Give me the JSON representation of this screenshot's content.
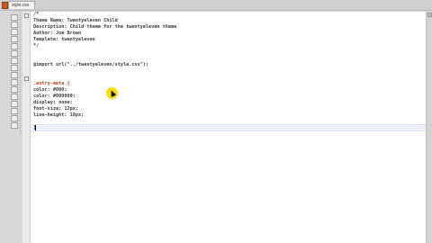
{
  "tab": {
    "label": "style.css"
  },
  "toolbar": {
    "buttons": [
      "tool-1",
      "tool-2",
      "tool-3",
      "tool-4",
      "tool-5",
      "tool-6",
      "tool-7",
      "tool-8",
      "tool-9",
      "tool-10",
      "tool-11",
      "tool-12",
      "tool-13",
      "tool-14",
      "tool-15",
      "tool-16"
    ]
  },
  "editor": {
    "lines": [
      "/*",
      "Theme Name: Twentyeleven Child",
      "Description: Child theme for the twentyeleven theme",
      "Author: Joe Brown",
      "Template: twentyeleven",
      "*/",
      "",
      "@import url(\"../twentyeleven/style.css\");",
      "",
      "",
      ".entry-meta {",
      "color: #000;",
      "color: #000000;",
      "display: none;",
      "font-size: 12px;",
      "line-height: 18px;",
      "}"
    ]
  }
}
